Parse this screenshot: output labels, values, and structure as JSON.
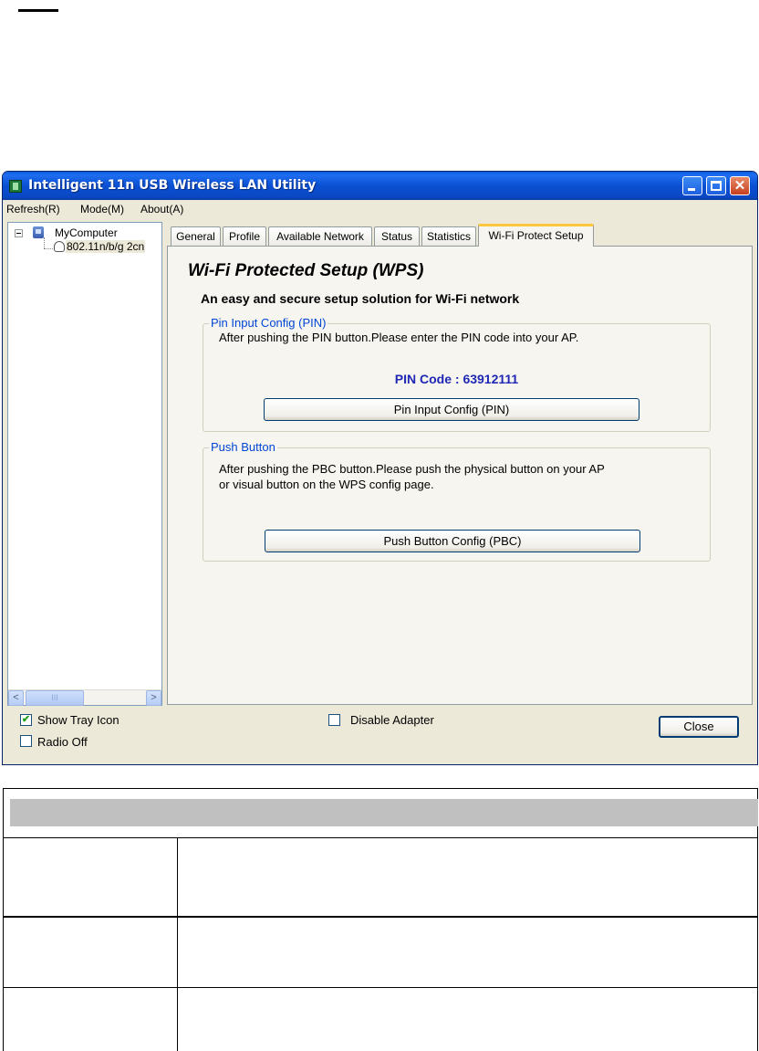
{
  "window": {
    "title": "Intelligent 11n USB Wireless LAN Utility",
    "close_glyph": "✕"
  },
  "menu": {
    "items": [
      "Refresh(R)",
      "Mode(M)",
      "About(A)"
    ]
  },
  "tree": {
    "root_label": "MyComputer",
    "adapter_label": "802.11n/b/g 2cn"
  },
  "scrollbar": {
    "left_arrow": "<",
    "right_arrow": ">",
    "thumb_grip": "III"
  },
  "tabs": [
    "General",
    "Profile",
    "Available Network",
    "Status",
    "Statistics",
    "Wi-Fi Protect Setup"
  ],
  "active_tab": "Wi-Fi Protect Setup",
  "wps": {
    "title": "Wi-Fi Protected Setup (WPS)",
    "subtitle": "An easy and secure setup solution for Wi-Fi network",
    "pin_group": {
      "legend": "Pin Input Config (PIN)",
      "text": "After pushing the PIN button.Please enter the PIN code into your AP.",
      "pin_code_label": "PIN Code :  63912111",
      "button_label": "Pin Input Config (PIN)"
    },
    "pbc_group": {
      "legend": "Push Button",
      "text_line1": "After pushing the PBC button.Please push the physical button on your AP",
      "text_line2": "or visual button on the WPS config page.",
      "button_label": "Push Button Config (PBC)"
    }
  },
  "bottom": {
    "show_tray_icon": {
      "label": "Show Tray Icon",
      "checked": true,
      "check_glyph": "✔"
    },
    "radio_off": {
      "label": "Radio Off",
      "checked": false
    },
    "disable_adapter": {
      "label": "Disable Adapter",
      "checked": false
    },
    "close_label": "Close"
  },
  "colors": {
    "titlebar": "#0a50d2",
    "pin_code": "#1e28b4",
    "group_legend": "#0046d5",
    "window_bg": "#ece9d8"
  }
}
